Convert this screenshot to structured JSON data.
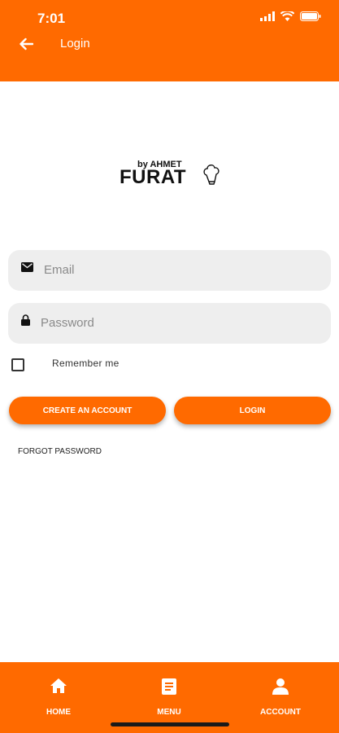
{
  "status_bar": {
    "time": "7:01"
  },
  "header": {
    "title": "Login"
  },
  "logo": {
    "by_text": "by AHMET",
    "name": "FURAT"
  },
  "form": {
    "email_placeholder": "Email",
    "password_placeholder": "Password",
    "remember_label": "Remember me",
    "remember_checked": false,
    "create_account_label": "CREATE AN ACCOUNT",
    "login_label": "LOGIN",
    "forgot_password_label": "FORGOT PASSWORD"
  },
  "bottom_nav": {
    "items": [
      {
        "label": "HOME",
        "icon": "home-icon"
      },
      {
        "label": "MENU",
        "icon": "menu-icon"
      },
      {
        "label": "ACCOUNT",
        "icon": "account-icon"
      }
    ]
  },
  "colors": {
    "accent": "#ff6a00",
    "field_bg": "#eeeeee"
  }
}
